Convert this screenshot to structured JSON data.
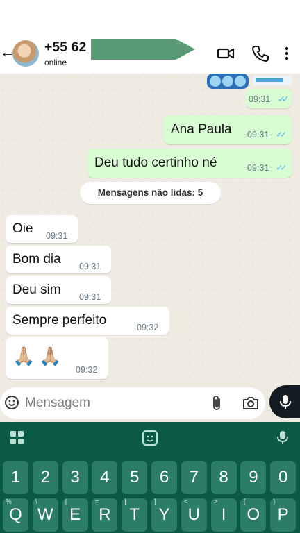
{
  "header": {
    "contact_phone": "+55 62",
    "status": "online"
  },
  "messages": [
    {
      "text": "Ana Paula",
      "time": "09:31",
      "dir": "out"
    },
    {
      "text": "Deu tudo certinho né",
      "time": "09:31",
      "dir": "out"
    },
    {
      "text": "Oie",
      "time": "09:31",
      "dir": "in"
    },
    {
      "text": "Bom dia",
      "time": "09:31",
      "dir": "in"
    },
    {
      "text": "Deu sim",
      "time": "09:31",
      "dir": "in"
    },
    {
      "text": "Sempre perfeito",
      "time": "09:32",
      "dir": "in"
    },
    {
      "text": "🙏🏼🙏🏼",
      "time": "09:32",
      "dir": "in"
    }
  ],
  "first_message_time": "09:31",
  "unread_banner": "Mensagens não lidas: 5",
  "composer": {
    "placeholder": "Mensagem"
  },
  "keyboard": {
    "numbers": [
      "1",
      "2",
      "3",
      "4",
      "5",
      "6",
      "7",
      "8",
      "9",
      "0"
    ],
    "letters": [
      {
        "key": "Q",
        "alt": "%"
      },
      {
        "key": "W",
        "alt": "\\"
      },
      {
        "key": "E",
        "alt": "|"
      },
      {
        "key": "R",
        "alt": "="
      },
      {
        "key": "T",
        "alt": "["
      },
      {
        "key": "Y",
        "alt": "]"
      },
      {
        "key": "U",
        "alt": "<"
      },
      {
        "key": "I",
        "alt": ">"
      },
      {
        "key": "O",
        "alt": "{"
      },
      {
        "key": "P",
        "alt": "}"
      }
    ]
  },
  "colors": {
    "outgoing_bubble": "#d9fdd3",
    "incoming_bubble": "#ffffff",
    "chat_background": "#efeae2",
    "keyboard_background": "#0b5a45",
    "key": "#2c7d66",
    "read_ticks": "#53bdeb",
    "redaction": "#5a9a74"
  },
  "icons": [
    "arrow-left-icon",
    "video-call-icon",
    "phone-icon",
    "more-vert-icon",
    "emoji-icon",
    "attach-icon",
    "camera-icon",
    "mic-icon",
    "grid-icon",
    "sticker-icon",
    "keyboard-mic-icon"
  ]
}
